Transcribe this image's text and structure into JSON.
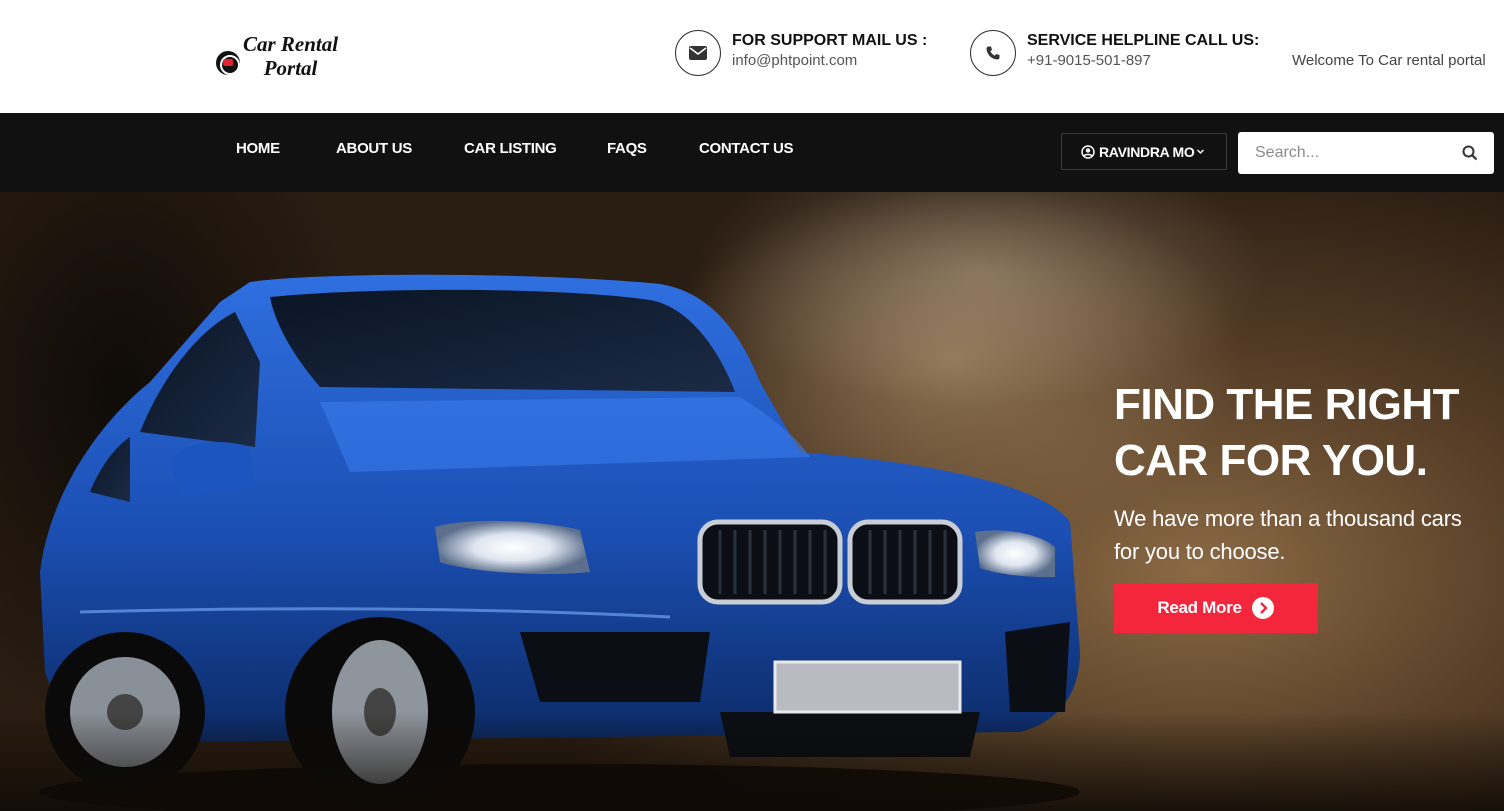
{
  "header": {
    "logo_line1": "Car Rental",
    "logo_line2": "Portal",
    "support": {
      "title": "FOR SUPPORT MAIL US :",
      "value": "info@phtpoint.com",
      "icon": "envelope-icon"
    },
    "helpline": {
      "title": "SERVICE HELPLINE CALL US:",
      "value": "+91-9015-501-897",
      "icon": "phone-icon"
    },
    "welcome": "Welcome To Car rental portal"
  },
  "nav": {
    "items": [
      {
        "label": "HOME"
      },
      {
        "label": "ABOUT US"
      },
      {
        "label": "CAR LISTING"
      },
      {
        "label": "FAQS"
      },
      {
        "label": "CONTACT US"
      }
    ],
    "user_label": "RAVINDRA MO",
    "search_placeholder": "Search..."
  },
  "hero": {
    "title_line1": "FIND THE RIGHT",
    "title_line2": "CAR FOR YOU.",
    "subtitle_line1": "We have more than a thousand cars",
    "subtitle_line2": "for you to choose.",
    "button_label": "Read More"
  },
  "colors": {
    "accent": "#f4263b",
    "navbar_bg": "#111111",
    "car_blue": "#1f5bc4"
  }
}
